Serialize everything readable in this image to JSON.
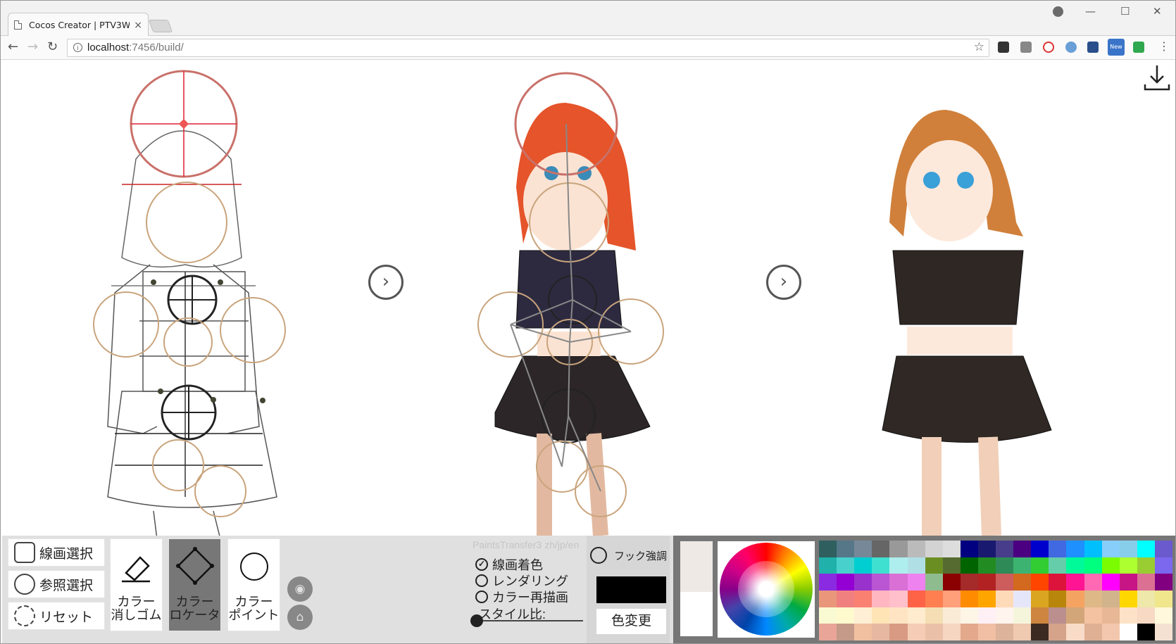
{
  "browser": {
    "tab_title": "Cocos Creator | PTV3W",
    "tab_close": "×",
    "url_host": "localhost",
    "url_rest": ":7456/build/",
    "window_controls": [
      "—",
      "☐",
      "✕"
    ],
    "nav_icons": [
      "arrow-left-icon",
      "arrow-right-icon",
      "reload-icon"
    ],
    "extension_colors": [
      "#333333",
      "#888888",
      "#d33333",
      "#6a9fd8",
      "#2a4f8a",
      "#3a74c9",
      "#2fa84f",
      "#666666"
    ],
    "ext_badge": "New"
  },
  "stage": {
    "arrow_glyph": "›",
    "download_icon": "download-icon",
    "figure_labels": [
      "sketch-with-pose-locators",
      "colored-with-pose-skeleton",
      "final-painted-figure"
    ]
  },
  "panel": {
    "line_select": "線画選択",
    "ref_select": "参照選択",
    "reset": "リセット",
    "tools": [
      {
        "label": "カラー\n消しゴム",
        "icon": "eraser-icon",
        "active": false
      },
      {
        "label": "カラー\nロケータ",
        "icon": "diamond-locator-icon",
        "active": true
      },
      {
        "label": "カラー\nポイント",
        "icon": "circle-point-icon",
        "active": false
      }
    ],
    "app_title": "PaintsTransfer3 zh/jp/en",
    "modes": [
      {
        "label": "線画着色",
        "checked": true
      },
      {
        "label": "レンダリング",
        "checked": false
      },
      {
        "label": "カラー再描画",
        "checked": false
      }
    ],
    "style_ratio": "スタイル比:",
    "hook": "フック強調",
    "color_change": "色変更",
    "current_color": "#000000"
  },
  "palette_colors": [
    "#2f5f5f",
    "#557788",
    "#778899",
    "#666666",
    "#999999",
    "#bbbbbb",
    "#d3d3d3",
    "#dddddd",
    "#000080",
    "#191970",
    "#483d8b",
    "#4b0082",
    "#0000cd",
    "#4169e1",
    "#1e90ff",
    "#00bfff",
    "#87cefa",
    "#87ceeb",
    "#00ffff",
    "#6a5acd",
    "#20b2aa",
    "#48d1cc",
    "#00ced1",
    "#40e0d0",
    "#afeeee",
    "#b0e0e6",
    "#6b8e23",
    "#556b2f",
    "#006400",
    "#228b22",
    "#2e8b57",
    "#3cb371",
    "#32cd32",
    "#66cdaa",
    "#00fa9a",
    "#00ff7f",
    "#7cfc00",
    "#adff2f",
    "#9acd32",
    "#7b68ee",
    "#8a2be2",
    "#9400d3",
    "#9932cc",
    "#ba55d3",
    "#da70d6",
    "#ee82ee",
    "#8fbc8f",
    "#8b0000",
    "#a52a2a",
    "#b22222",
    "#cd5c5c",
    "#d2691e",
    "#ff4500",
    "#dc143c",
    "#ff1493",
    "#ff69b4",
    "#ff00ff",
    "#c71585",
    "#db7093",
    "#800080",
    "#e9967a",
    "#f08080",
    "#fa8072",
    "#ffb6c1",
    "#ffc0cb",
    "#ff6347",
    "#ff7f50",
    "#ffa07a",
    "#ff8c00",
    "#ffa500",
    "#ffdab9",
    "#e6e6fa",
    "#daa520",
    "#b8860b",
    "#f4a460",
    "#deb887",
    "#d2b48c",
    "#ffd700",
    "#eee8aa",
    "#f0e68c",
    "#fafad2",
    "#fffacd",
    "#ffefd5",
    "#ffe4b5",
    "#ffe4c4",
    "#ffebcd",
    "#f5deb3",
    "#faebd7",
    "#fdf5e6",
    "#fff0f5",
    "#fff5ee",
    "#f5f5dc",
    "#cd853f",
    "#bc8f8f",
    "#d2a679",
    "#f4c2a1",
    "#e8b796",
    "#fde2c7",
    "#f7d9c4",
    "#fff8dc",
    "#e8a598",
    "#c49a88",
    "#f0c0a0",
    "#e6b8a2",
    "#d99a83",
    "#f5cdb6",
    "#eac1a8",
    "#f6d5c1",
    "#e3a98c",
    "#f1bfa3",
    "#dcb49c",
    "#efc9b0",
    "#3b2a22",
    "#d4a38a",
    "#f9dcc8",
    "#e0b094",
    "#f3c7ae",
    "#ffffff",
    "#000000",
    "#f4e1d2"
  ]
}
